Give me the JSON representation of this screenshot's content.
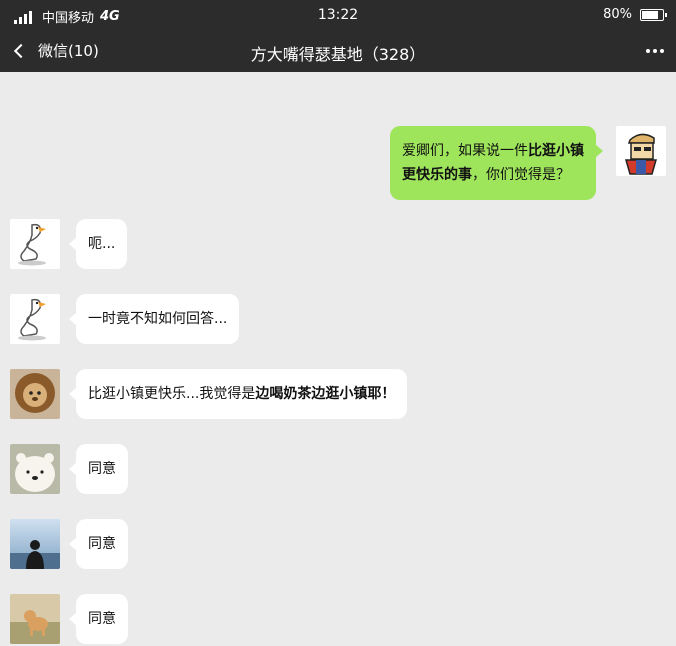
{
  "status_bar": {
    "carrier": "中国移动",
    "network": "4G",
    "time": "13:22",
    "battery": "80%",
    "battery_level": 0.8
  },
  "nav": {
    "back_label": "微信(10)",
    "title": "方大嘴得瑟基地（328）"
  },
  "messages": [
    {
      "sender": "me",
      "parts": [
        {
          "text": "爱卿们，如果说一件"
        },
        {
          "text": "比逛小镇",
          "bold": true
        }
      ],
      "parts2": [
        {
          "text": "更快乐的事",
          "bold": true
        },
        {
          "text": "，你们觉得是？"
        }
      ]
    },
    {
      "sender": "other",
      "text": "呃..."
    },
    {
      "sender": "other",
      "text": "一时竟不知如何回答..."
    },
    {
      "sender": "other",
      "text": "比逛小镇更快乐...我觉得是",
      "bold_text": "边喝奶茶边逛小镇耶！"
    },
    {
      "sender": "other",
      "text": "同意"
    },
    {
      "sender": "other",
      "text": "同意"
    },
    {
      "sender": "other",
      "text": "同意"
    }
  ]
}
